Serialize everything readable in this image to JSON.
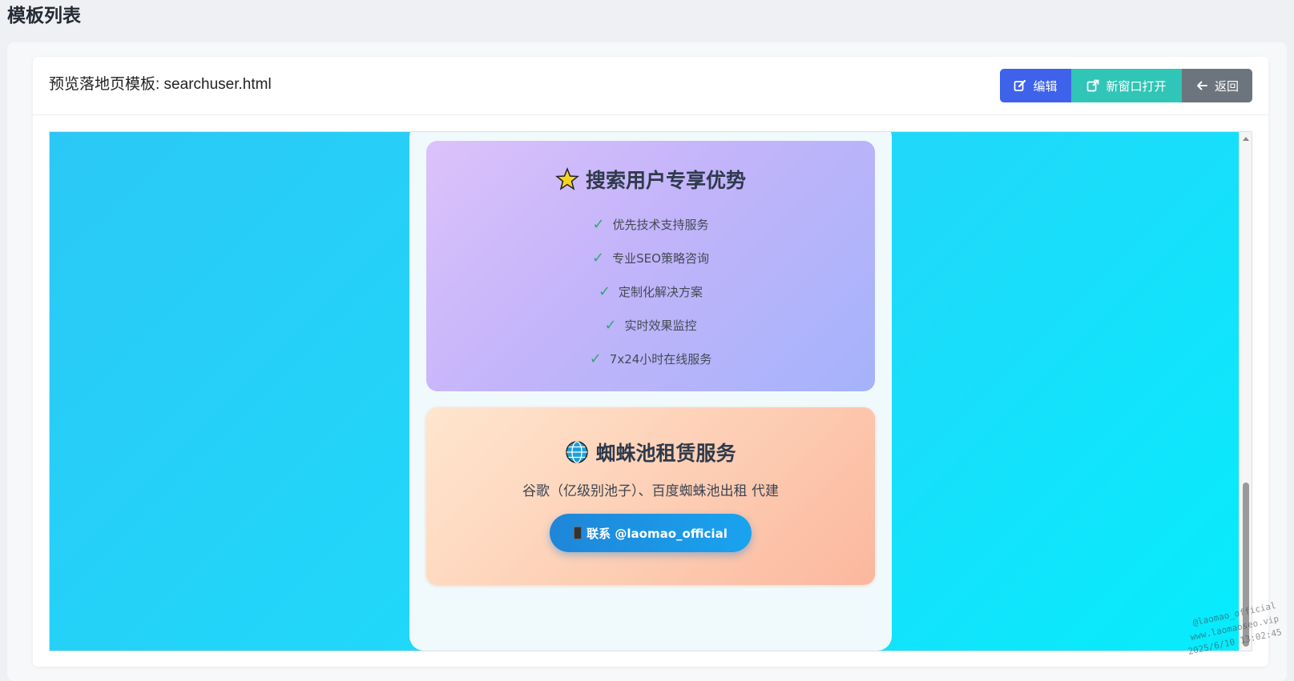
{
  "page": {
    "title": "模板列表"
  },
  "header": {
    "title": "预览落地页模板: searchuser.html",
    "buttons": {
      "edit": "编辑",
      "open_new": "新窗口打开",
      "back": "返回"
    }
  },
  "preview": {
    "advantages": {
      "icon": "star-icon",
      "title": "搜索用户专享优势",
      "items": [
        "优先技术支持服务",
        "专业SEO策略咨询",
        "定制化解决方案",
        "实时效果监控",
        "7x24小时在线服务"
      ]
    },
    "spider": {
      "icon": "globe-icon",
      "title": "蜘蛛池租赁服务",
      "desc": "谷歌（亿级别池子）、百度蜘蛛池出租 代建",
      "contact": "联系 @laomao_official"
    }
  },
  "watermark": {
    "line1": "@laomao_official",
    "line2": "www.laomaoseo.vip",
    "line3": "2025/6/10 13:02:45"
  },
  "colors": {
    "primary": "#3e62ea",
    "teal": "#30c5b6",
    "gray": "#6c757d",
    "check": "#2ea876"
  }
}
